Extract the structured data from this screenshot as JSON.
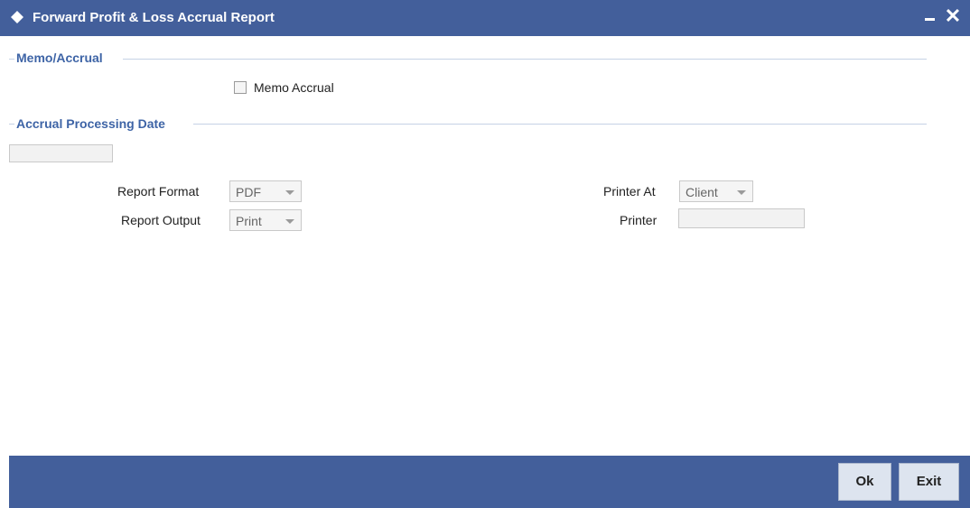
{
  "window": {
    "title": "Forward Profit & Loss Accrual Report"
  },
  "sections": {
    "memo": {
      "heading": "Memo/Accrual"
    },
    "accrual": {
      "heading": "Accrual Processing Date"
    }
  },
  "memo_accrual": {
    "label": "Memo Accrual",
    "checked": false
  },
  "accrual_date": {
    "value": ""
  },
  "report": {
    "format_label": "Report Format",
    "format_value": "PDF",
    "output_label": "Report Output",
    "output_value": "Print",
    "printer_at_label": "Printer At",
    "printer_at_value": "Client",
    "printer_label": "Printer",
    "printer_value": ""
  },
  "footer": {
    "ok_label": "Ok",
    "exit_label": "Exit"
  },
  "colors": {
    "titlebar": "#435f9b",
    "section_heading": "#3e64a6",
    "footer": "#435f9b"
  }
}
